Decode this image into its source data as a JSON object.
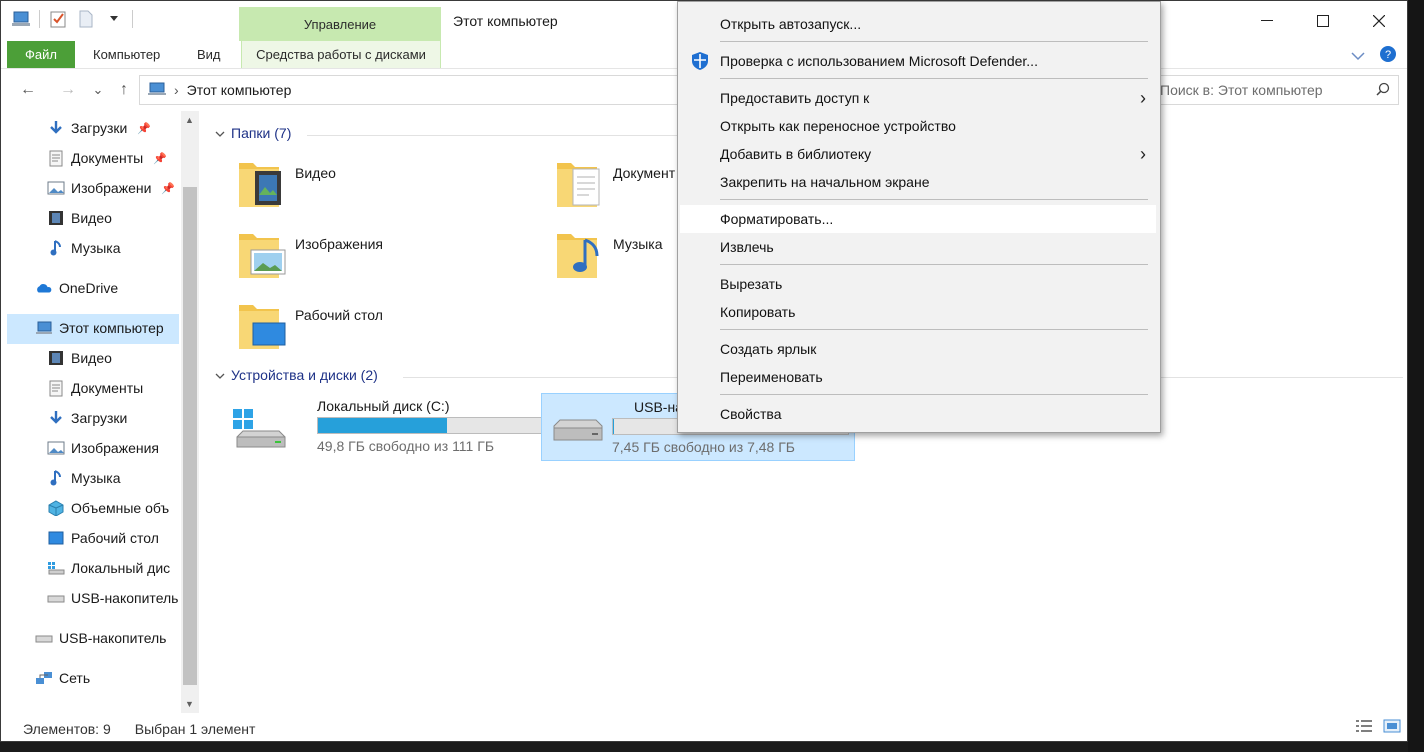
{
  "window": {
    "title": "Этот компьютер",
    "contextual_tab_group": "Управление"
  },
  "ribbon": {
    "tabs": [
      "Файл",
      "Компьютер",
      "Вид",
      "Средства работы с дисками"
    ]
  },
  "navigation": {
    "back": "←",
    "forward": "→",
    "recent": "⌄",
    "up": "↑",
    "address_path": "Этот компьютер",
    "search_placeholder": "Поиск в: Этот компьютер"
  },
  "sidebar": {
    "quick_access": [
      {
        "label": "Загрузки",
        "icon": "download-arrow-icon",
        "pinned": true
      },
      {
        "label": "Документы",
        "icon": "documents-icon",
        "pinned": true
      },
      {
        "label": "Изображени",
        "icon": "pictures-icon",
        "pinned": true
      },
      {
        "label": "Видео",
        "icon": "video-icon",
        "pinned": false
      },
      {
        "label": "Музыка",
        "icon": "music-icon",
        "pinned": false
      }
    ],
    "onedrive": "OneDrive",
    "this_pc": "Этот компьютер",
    "this_pc_children": [
      {
        "label": "Видео",
        "icon": "video-icon"
      },
      {
        "label": "Документы",
        "icon": "documents-icon"
      },
      {
        "label": "Загрузки",
        "icon": "download-arrow-icon"
      },
      {
        "label": "Изображения",
        "icon": "pictures-icon"
      },
      {
        "label": "Музыка",
        "icon": "music-icon"
      },
      {
        "label": "Объемные объ",
        "icon": "3d-objects-icon"
      },
      {
        "label": "Рабочий стол",
        "icon": "desktop-icon"
      },
      {
        "label": "Локальный дис",
        "icon": "local-disk-icon"
      },
      {
        "label": "USB-накопитель",
        "icon": "usb-drive-icon"
      }
    ],
    "usb": "USB-накопитель",
    "network": "Сеть"
  },
  "content": {
    "folders_header": "Папки (7)",
    "folders": [
      {
        "label": "Видео",
        "icon": "video-folder-icon"
      },
      {
        "label": "Документ",
        "icon": "documents-folder-icon"
      },
      {
        "label": "Изображения",
        "icon": "pictures-folder-icon"
      },
      {
        "label": "Музыка",
        "icon": "music-folder-icon"
      },
      {
        "label": "Рабочий стол",
        "icon": "desktop-folder-icon"
      }
    ],
    "drives_header": "Устройства и диски (2)",
    "drives": [
      {
        "label": "Локальный диск (C:)",
        "free": "49,8 ГБ свободно из 111 ГБ",
        "used_fraction": 0.55,
        "selected": false
      },
      {
        "label": "USB-нако",
        "free": "7,45 ГБ свободно из 7,48 ГБ",
        "used_fraction": 0.004,
        "selected": true
      }
    ]
  },
  "status": {
    "items": "Элементов: 9",
    "selected": "Выбран 1 элемент"
  },
  "context_menu": {
    "items": [
      {
        "label": "Открыть автозапуск...",
        "submenu": false
      },
      {
        "label": "Проверка с использованием Microsoft Defender...",
        "submenu": false,
        "icon": "defender-shield-icon"
      },
      {
        "label": "Предоставить доступ к",
        "submenu": true
      },
      {
        "label": "Открыть как переносное устройство",
        "submenu": false
      },
      {
        "label": "Добавить в библиотеку",
        "submenu": true
      },
      {
        "label": "Закрепить на начальном экране",
        "submenu": false
      },
      {
        "label": "Форматировать...",
        "submenu": false,
        "hover": true
      },
      {
        "label": "Извлечь",
        "submenu": false
      },
      {
        "label": "Вырезать",
        "submenu": false
      },
      {
        "label": "Копировать",
        "submenu": false
      },
      {
        "label": "Создать ярлык",
        "submenu": false
      },
      {
        "label": "Переименовать",
        "submenu": false
      },
      {
        "label": "Свойства",
        "submenu": false
      }
    ]
  },
  "colors": {
    "file_tab": "#4c9f38",
    "contextual_tab": "#c7e9b0",
    "selection": "#cce8ff",
    "drive_bar": "#26a0da",
    "group_header": "#1e3287"
  }
}
